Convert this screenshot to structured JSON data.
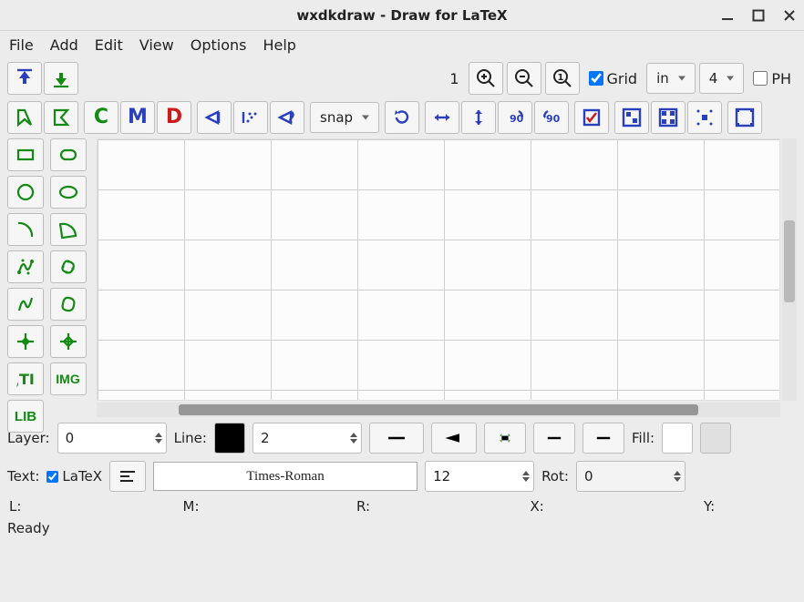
{
  "window": {
    "title": "wxdkdraw - Draw for LaTeX"
  },
  "menu": {
    "file": "File",
    "add": "Add",
    "edit": "Edit",
    "view": "View",
    "options": "Options",
    "help": "Help"
  },
  "toolbar1": {
    "zoom_value": "1",
    "grid_label": "Grid",
    "grid_checked": true,
    "unit": "in",
    "gridsub": "4",
    "ph_label": "PH",
    "ph_checked": false
  },
  "toolbar2": {
    "snap_label": "snap",
    "letters": {
      "C": "C",
      "M": "M",
      "D": "D"
    }
  },
  "palette": {
    "lib": "LIB",
    "img": "IMG"
  },
  "props": {
    "layer_label": "Layer:",
    "layer_value": "0",
    "line_label": "Line:",
    "line_width": "2",
    "fill_label": "Fill:",
    "text_label": "Text:",
    "latex_label": "LaTeX",
    "latex_checked": true,
    "font_name": "Times-Roman",
    "font_size": "12",
    "rot_label": "Rot:",
    "rot_value": "0"
  },
  "coords": {
    "L": "L:",
    "M": "M:",
    "R": "R:",
    "X": "X:",
    "Y": "Y:"
  },
  "status": {
    "ready": "Ready"
  }
}
